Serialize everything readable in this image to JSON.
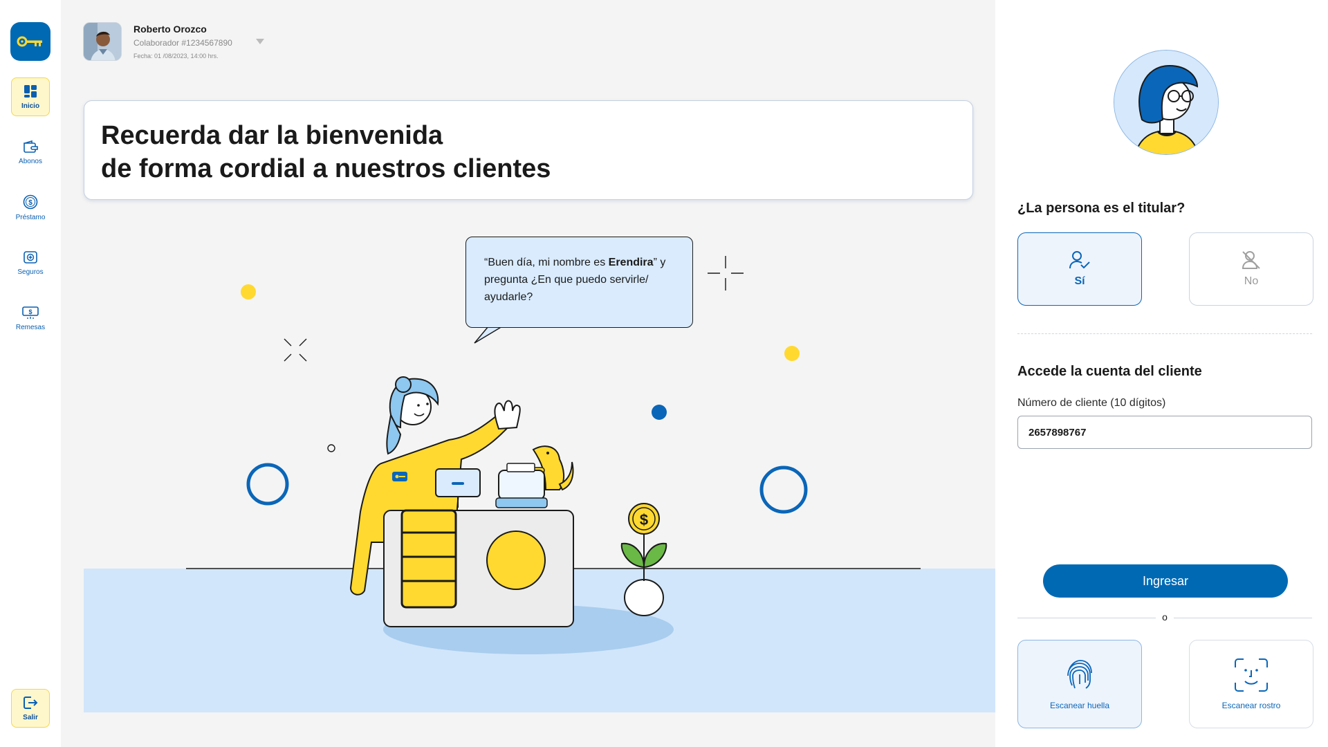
{
  "sidebar": {
    "logo_icon": "key-icon",
    "items": [
      {
        "label": "Inicio",
        "icon": "dashboard-icon",
        "active": true
      },
      {
        "label": "Abonos",
        "icon": "wallet-icon"
      },
      {
        "label": "Préstamo",
        "icon": "dollar-coin-icon"
      },
      {
        "label": "Seguros",
        "icon": "insurance-icon"
      },
      {
        "label": "Remesas",
        "icon": "remittance-icon"
      }
    ],
    "logout_label": "Salir"
  },
  "user": {
    "name": "Roberto Orozco",
    "id": "Colaborador #1234567890",
    "date": "Fecha: 01 /08/2023, 14:00 hrs."
  },
  "banner": {
    "line1": "Recuerda dar la bienvenida",
    "line2": "de forma cordial a nuestros clientes"
  },
  "bubble": {
    "before": "“Buen día, mi nombre es ",
    "name": "Erendira",
    "after": "” y pregunta ¿En que puedo servirle/ ayudarle?"
  },
  "panel": {
    "question": "¿La persona es el titular?",
    "yes_label": "Sí",
    "no_label": "No",
    "access_title": "Accede la cuenta del cliente",
    "client_field_label": "Número de cliente (10 dígitos)",
    "client_number": "2657898767",
    "submit_label": "Ingresar",
    "or_label": "o",
    "scan_finger_label": "Escanear huella",
    "scan_face_label": "Escanear rostro"
  },
  "colors": {
    "primary": "#0069b4",
    "accent_yellow": "#ffd930",
    "light_blue": "#d2e6fb"
  }
}
